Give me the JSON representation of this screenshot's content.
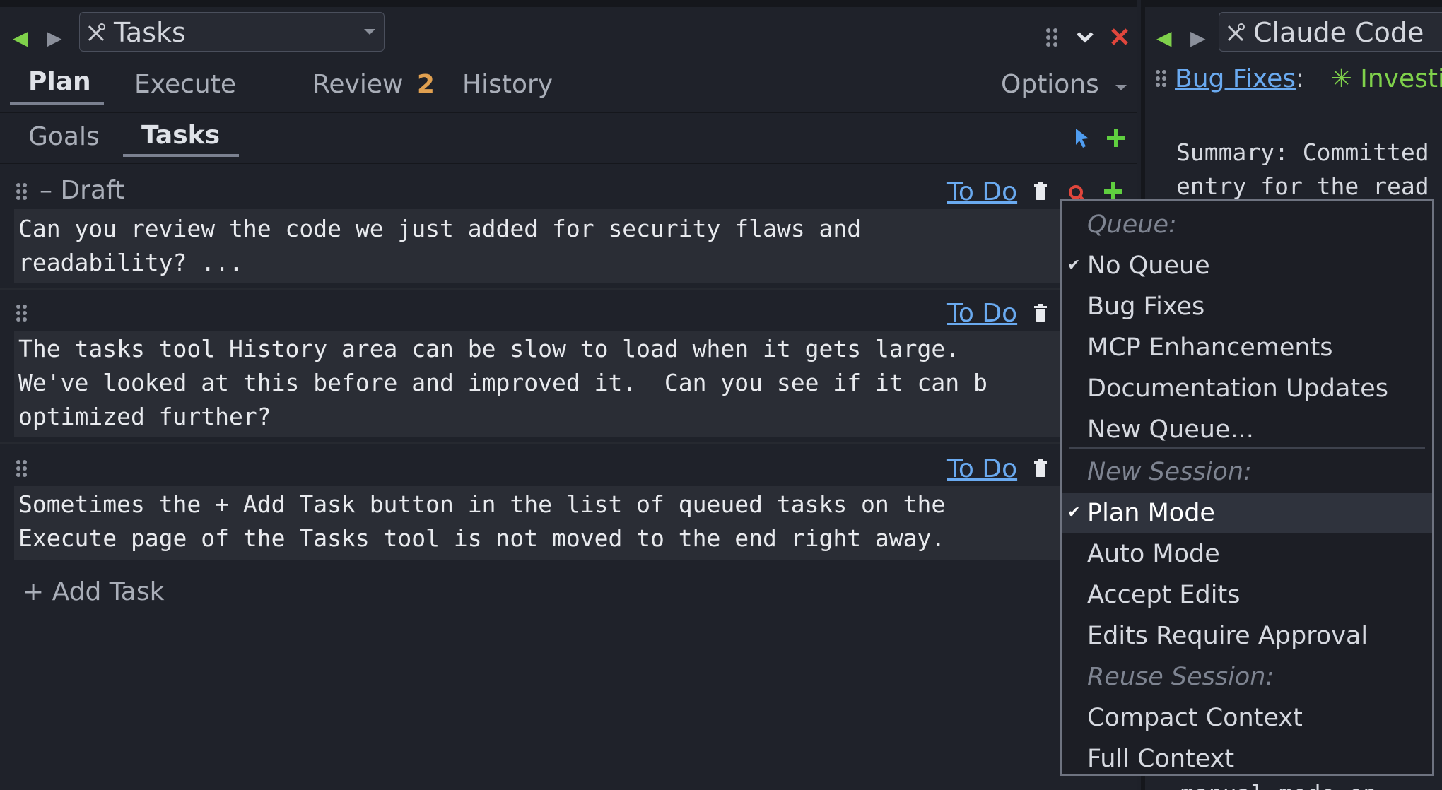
{
  "left_panel": {
    "title": "Tasks",
    "main_tabs": [
      {
        "label": "Plan"
      },
      {
        "label": "Execute"
      },
      {
        "label": "Review"
      },
      {
        "label": "History"
      }
    ],
    "review_badge": "2",
    "options_label": "Options",
    "sub_tabs": [
      {
        "label": "Goals"
      },
      {
        "label": "Tasks"
      }
    ],
    "tasks": [
      {
        "section": "Draft",
        "status": "To Do",
        "text": "Can you review the code we just added for security flaws and\nreadability? ..."
      },
      {
        "status": "To Do",
        "text": "The tasks tool History area can be slow to load when it gets large.\nWe've looked at this before and improved it.  Can you see if it can b\noptimized further?"
      },
      {
        "status": "To Do",
        "text": "Sometimes the + Add Task button in the list of queued tasks on the\nExecute page of the Tasks tool is not moved to the end right away."
      }
    ],
    "add_task_label": "+ Add Task"
  },
  "right_panel": {
    "title": "Claude Code",
    "queue_link": "Bug Fixes",
    "status_text": "✳ Investig",
    "summary_line1": "Summary: Committed",
    "summary_line2": "entry for the read",
    "bottom_text": "manual mode on"
  },
  "queue_menu": {
    "queue_header": "Queue:",
    "queue_items": [
      "No Queue",
      "Bug Fixes",
      "MCP Enhancements",
      "Documentation Updates",
      "New Queue..."
    ],
    "new_session_header": "New Session:",
    "session_items": [
      "Plan Mode",
      "Auto Mode",
      "Accept Edits",
      "Edits Require Approval"
    ],
    "reuse_header": "Reuse Session:",
    "reuse_items": [
      "Compact Context",
      "Full Context"
    ]
  },
  "colors": {
    "accent_green": "#5fcf3f",
    "nav_green": "#7fd14b",
    "close_red": "#e0463c",
    "link_blue": "#6aaaf0",
    "badge_orange": "#e0a050"
  }
}
